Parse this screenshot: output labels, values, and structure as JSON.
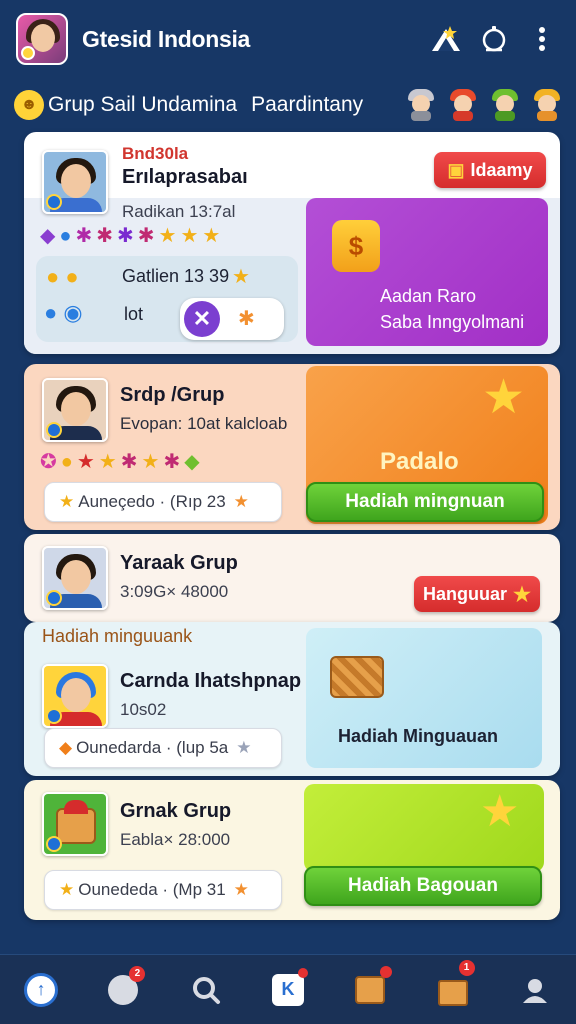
{
  "header": {
    "title": "Gtesid Indonsia",
    "icons": [
      "avatar",
      "trophy-icon",
      "notification-icon",
      "more-vertical-icon"
    ]
  },
  "subheader": {
    "left_label": "Grup Sail Undamina",
    "right_label": "Paardintany",
    "icons": [
      "sun-icon",
      "character-icons"
    ]
  },
  "cards": {
    "c1": {
      "tag": "Bnd30la",
      "name": "Erılaprasabaı",
      "meta": "Radikan 13:7al",
      "button": "Idaamy",
      "inner_title": "Gatlien 13 39",
      "inner_label": "lot",
      "promo_line1": "Aadan Raro",
      "promo_line2": "Saba Inngyolmani",
      "accent": "#b93fd0"
    },
    "c2": {
      "name": "Srdp /Grup",
      "meta": "Evopan: 10at kalcloab",
      "pill": "Auneçedo · (Rıp 23",
      "promo_title": "Padalo",
      "button": "Hadiah mingnuan",
      "accent": "#f58f2b"
    },
    "c3": {
      "name": "Yaraak Grup",
      "meta": "3:09G× 48000",
      "button": "Hanguuar"
    },
    "c4": {
      "header": "Hadiah minguuank",
      "name": "Carnda Ihatshpnap",
      "meta": "10s02",
      "pill": "Ounedarda · (lup 5a",
      "promo_label": "Hadiah Minguauan"
    },
    "c5": {
      "name": "Grnak Grup",
      "meta": "Eabla× 28:000",
      "pill": "Ounededa · (Mp 31",
      "button": "Hadiah Bagouan",
      "accent": "#a3e02a"
    }
  },
  "bottom_nav": {
    "items": [
      "home-icon",
      "chat-icon",
      "search-icon",
      "app-icon",
      "inbox-icon",
      "gift-icon",
      "profile-icon"
    ],
    "badges": {
      "chat": "2",
      "app": "",
      "inbox": "",
      "gift": "1"
    }
  }
}
